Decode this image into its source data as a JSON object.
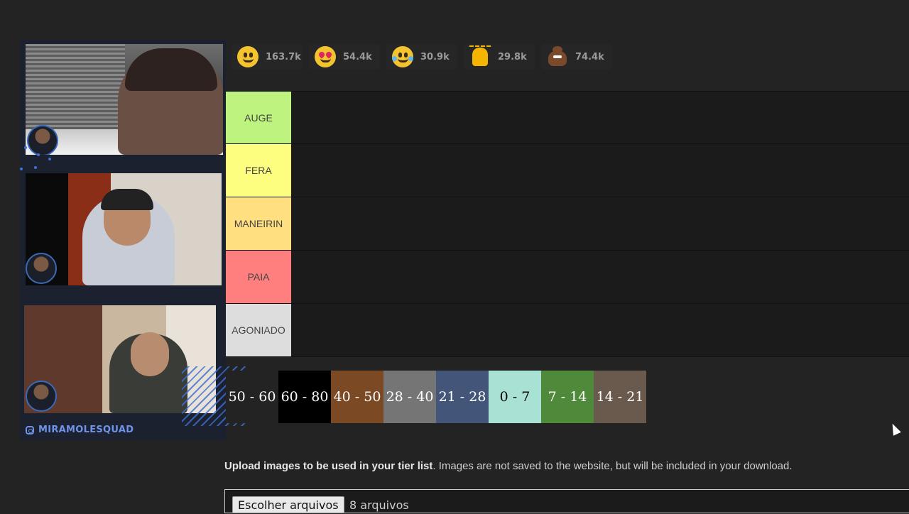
{
  "overlay": {
    "handle": "MIRAMOLESQUAD"
  },
  "reactions": [
    {
      "icon": "smiley-icon",
      "count": "163.7k"
    },
    {
      "icon": "heart-eyes-icon",
      "count": "54.4k"
    },
    {
      "icon": "tears-of-joy-icon",
      "count": "30.9k"
    },
    {
      "icon": "raising-hands-icon",
      "count": "29.8k"
    },
    {
      "icon": "poop-icon",
      "count": "74.4k"
    }
  ],
  "tiers": [
    {
      "label": "AUGE",
      "color": "#bff37f"
    },
    {
      "label": "FERA",
      "color": "#fdfd7f"
    },
    {
      "label": "MANEIRIN",
      "color": "#ffdf80"
    },
    {
      "label": "PAIA",
      "color": "#ff7f7f"
    },
    {
      "label": "AGONIADO",
      "color": "#dddddd"
    }
  ],
  "items": [
    {
      "label": "50 - 60",
      "color": "#232323"
    },
    {
      "label": "60 - 80",
      "color": "#000000"
    },
    {
      "label": "40 - 50",
      "color": "#7b4a25"
    },
    {
      "label": "28 - 40",
      "color": "#757575"
    },
    {
      "label": "21 - 28",
      "color": "#44557a"
    },
    {
      "label": "0 - 7",
      "color": "#a9e2d4",
      "text_color": "#000000"
    },
    {
      "label": "7 - 14",
      "color": "#4f8a3a"
    },
    {
      "label": "14 - 21",
      "color": "#6a5a4d"
    }
  ],
  "upload": {
    "bold_text": "Upload images to be used in your tier list",
    "rest_text": ". Images are not saved to the website, but will be included in your download.",
    "button_label": "Escolher arquivos",
    "status": "8 arquivos"
  }
}
